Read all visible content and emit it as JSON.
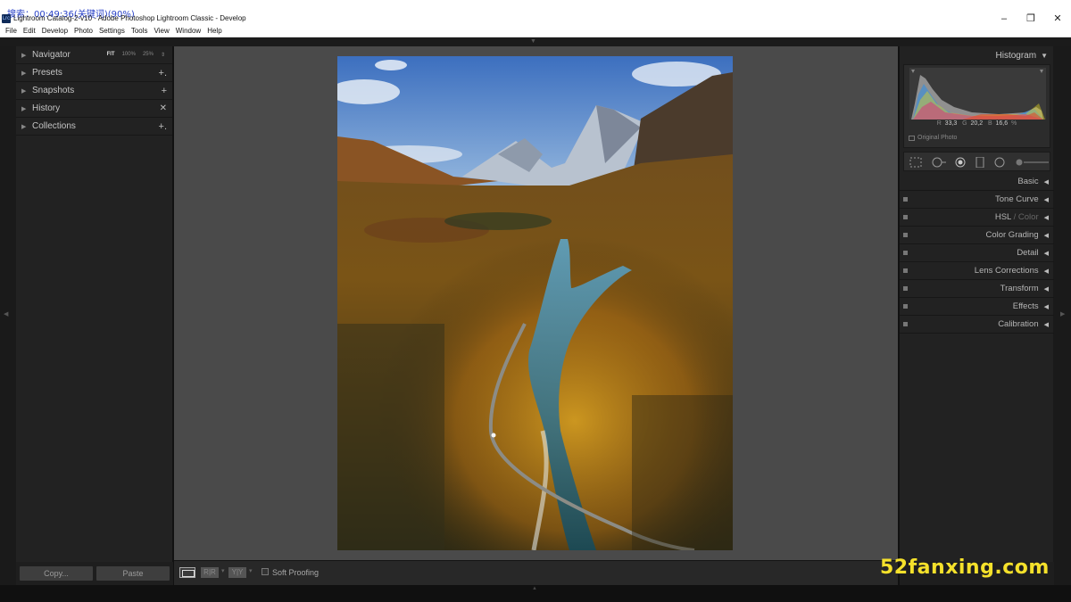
{
  "overlay_text": "搜索：00:49:36(关键词)(90%)",
  "window": {
    "icon_label": "Lrc",
    "title": "Lightroom Catalog-2-v10 - Adobe Photoshop Lightroom Classic - Develop",
    "controls": [
      "–",
      "❐",
      "✕"
    ]
  },
  "menu": [
    "File",
    "Edit",
    "Develop",
    "Photo",
    "Settings",
    "Tools",
    "View",
    "Window",
    "Help"
  ],
  "left_panel": {
    "navigator": {
      "label": "Navigator",
      "zoom": [
        "FIT",
        "100%",
        "25%"
      ],
      "zoom_arrow": "⇕"
    },
    "presets": {
      "label": "Presets",
      "action": "+."
    },
    "snapshots": {
      "label": "Snapshots",
      "action": "+"
    },
    "history": {
      "label": "History",
      "action": "✕"
    },
    "collections": {
      "label": "Collections",
      "action": "+."
    },
    "copy_button": "Copy...",
    "paste_button": "Paste"
  },
  "toolbar": {
    "before_after": "R|R",
    "swap": "Y|Y",
    "caret": "▾",
    "soft_proofing": "Soft Proofing"
  },
  "right_panel": {
    "histogram": {
      "title": "Histogram",
      "r_label": "R",
      "r_value": "33,3",
      "g_label": "G",
      "g_value": "20,2",
      "b_label": "B",
      "b_value": "16,6",
      "unit": "%",
      "original_photo": "Original Photo"
    },
    "sections": {
      "basic": "Basic",
      "tone_curve": "Tone Curve",
      "hsl": "HSL",
      "hsl_sep": " / ",
      "color": "Color",
      "color_grading": "Color Grading",
      "detail": "Detail",
      "lens_corrections": "Lens Corrections",
      "transform": "Transform",
      "effects": "Effects",
      "calibration": "Calibration"
    }
  },
  "watermark": "52fanxing.com",
  "colors": {
    "panel_bg": "#222222",
    "canvas_bg": "#4a4a4a",
    "watermark": "#f5e12b"
  }
}
